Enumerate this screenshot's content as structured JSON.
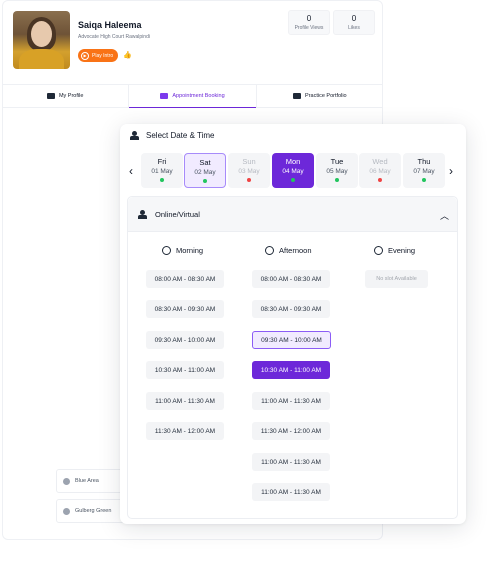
{
  "profile": {
    "name": "Saiqa Haleema",
    "subtitle": "Advocate High Court Rawalpindi",
    "play_label": "Play Intro",
    "stats": [
      {
        "value": "0",
        "label": "Profile Views"
      },
      {
        "value": "0",
        "label": "Likes"
      }
    ]
  },
  "tabs": [
    {
      "label": "My Profile",
      "icon": "id-card-icon"
    },
    {
      "label": "Appointment Booking",
      "icon": "calendar-icon"
    },
    {
      "label": "Practice Portfolio",
      "icon": "portfolio-icon"
    }
  ],
  "locations": [
    {
      "label": "Blue Area"
    },
    {
      "label": "Gulberg Green"
    }
  ],
  "booking": {
    "title": "Select Date & Time",
    "days": [
      {
        "name": "Fri",
        "date": "01 May",
        "status": "available"
      },
      {
        "name": "Sat",
        "date": "02 May",
        "status": "available"
      },
      {
        "name": "Sun",
        "date": "03 May",
        "status": "unavailable"
      },
      {
        "name": "Mon",
        "date": "04 May",
        "status": "available"
      },
      {
        "name": "Tue",
        "date": "05 May",
        "status": "available"
      },
      {
        "name": "Wed",
        "date": "06 May",
        "status": "unavailable"
      },
      {
        "name": "Thu",
        "date": "07 May",
        "status": "available"
      }
    ],
    "mode": "Online/Virtual",
    "periods": {
      "morning": "Morning",
      "afternoon": "Afternoon",
      "evening": "Evening"
    },
    "morning_slots": [
      "08:00 AM - 08:30 AM",
      "08:30 AM - 09:30 AM",
      "09:30 AM - 10:00 AM",
      "10:30 AM - 11:00 AM",
      "11:00 AM - 11:30 AM",
      "11:30 AM - 12:00 AM"
    ],
    "afternoon_slots": [
      "08:00 AM - 08:30 AM",
      "08:30 AM - 09:30 AM",
      "09:30 AM - 10:00 AM",
      "10:30 AM - 11:00 AM",
      "11:00 AM - 11:30 AM",
      "11:30 AM - 12:00 AM",
      "11:00 AM - 11:30 AM",
      "11:00 AM - 11:30 AM"
    ],
    "evening_empty": "No slot Available"
  },
  "colors": {
    "accent": "#6d28d9",
    "accent_light": "#f1ebff",
    "play": "#f97316",
    "available_dot": "#22c55e",
    "unavailable_dot": "#ef4444"
  }
}
